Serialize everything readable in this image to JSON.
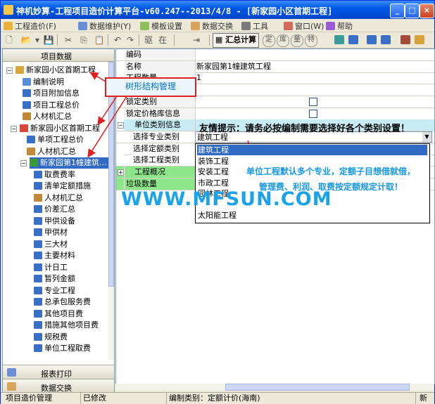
{
  "window": {
    "title": "神机妙算-工程项目造价计算平台-v60.247--2013/4/8 - [新家园小区首期工程]",
    "controls": {
      "minimize": "_",
      "maximize": "□",
      "close": "×"
    }
  },
  "menu": [
    {
      "label": "工程造价(F)",
      "icon": "folder-icon",
      "color": "#e8b23a"
    },
    {
      "label": "数据维护(Y)",
      "icon": "database-icon",
      "color": "#6b8fd6"
    },
    {
      "label": "模板设置",
      "icon": "template-icon",
      "color": "#8fbf5a"
    },
    {
      "label": "数据交换",
      "icon": "exchange-icon",
      "color": "#d6a45a"
    },
    {
      "label": "工具",
      "icon": "tools-icon",
      "color": "#7a7a7a"
    },
    {
      "label": "窗口(W)",
      "icon": "window-icon",
      "color": "#d66a5a"
    },
    {
      "label": "帮助",
      "icon": "help-icon",
      "color": "#9a5ad6"
    }
  ],
  "toolbar": {
    "glyphs": [
      "🗋",
      "📂",
      "▾",
      "💾",
      "✂",
      "⎘",
      "📋",
      "↶",
      "↷",
      "驱",
      "在",
      "⇥",
      "⎙"
    ],
    "calc_label": "汇总计算",
    "glyphs2": [
      "定",
      "库",
      "量",
      "特"
    ]
  },
  "left_panel": {
    "header": "项目数据",
    "tree": [
      {
        "label": "新家园小区首期工程",
        "level": 0,
        "expander": "−",
        "icon_color": "#d9a63a"
      },
      {
        "label": "编制说明",
        "level": 1,
        "icon_color": "#5a8fd6"
      },
      {
        "label": "项目附加信息",
        "level": 1,
        "icon_color": "#3a6fc6"
      },
      {
        "label": "项目工程总价",
        "level": 1,
        "icon_color": "#3a6fc6"
      },
      {
        "label": "人材机汇总",
        "level": 1,
        "icon_color": "#c08a3a"
      },
      {
        "label": "新家园小区首期工程",
        "level": 1,
        "expander": "−",
        "icon_color": "#d9463a"
      },
      {
        "label": "单项工程总价",
        "level": 2,
        "icon_color": "#3a6fc6"
      },
      {
        "label": "人材机汇总",
        "level": 2,
        "icon_color": "#c08a3a"
      },
      {
        "label": "新家园第1幢建筑...",
        "level": 2,
        "expander": "−",
        "icon_color": "#3a9a3a",
        "selected": true
      },
      {
        "label": "取费费率",
        "level": 3,
        "icon_color": "#3a6fc6"
      },
      {
        "label": "清单定额措施",
        "level": 3,
        "icon_color": "#3a6fc6"
      },
      {
        "label": "人材机汇总",
        "level": 3,
        "icon_color": "#c08a3a"
      },
      {
        "label": "价差汇总",
        "level": 3,
        "icon_color": "#3a6fc6"
      },
      {
        "label": "甲供设备",
        "level": 3,
        "icon_color": "#3a6fc6"
      },
      {
        "label": "甲供材",
        "level": 3,
        "icon_color": "#3a6fc6"
      },
      {
        "label": "三大材",
        "level": 3,
        "icon_color": "#3a6fc6"
      },
      {
        "label": "主要材料",
        "level": 3,
        "icon_color": "#3a6fc6"
      },
      {
        "label": "计日工",
        "level": 3,
        "icon_color": "#3a6fc6"
      },
      {
        "label": "暂列金额",
        "level": 3,
        "icon_color": "#3a6fc6"
      },
      {
        "label": "专业工程",
        "level": 3,
        "icon_color": "#3a6fc6"
      },
      {
        "label": "总承包服务费",
        "level": 3,
        "icon_color": "#3a6fc6"
      },
      {
        "label": "其他项目费",
        "level": 3,
        "icon_color": "#3a6fc6"
      },
      {
        "label": "措施其他项目费",
        "level": 3,
        "icon_color": "#3a6fc6"
      },
      {
        "label": "规税费",
        "level": 3,
        "icon_color": "#3a6fc6"
      },
      {
        "label": "单位工程取费",
        "level": 3,
        "icon_color": "#3a6fc6"
      }
    ],
    "report_button": "报表打印",
    "exchange_button": "数据交换"
  },
  "properties": {
    "rows": [
      {
        "key": "编码",
        "value": ""
      },
      {
        "key": "名称",
        "value": "新家园第1幢建筑工程"
      },
      {
        "key": "工程数量",
        "value": "1"
      },
      {
        "key": "",
        "value": ""
      },
      {
        "key": "锁定类别",
        "value": "",
        "checkbox": true
      },
      {
        "key": "锁定价格库信息",
        "value": "",
        "checkbox": true
      }
    ],
    "section_unit": {
      "expander": "−",
      "label": "单位类别信息",
      "tip": "友情提示：请务必按编制需要选择好各个类别设置！"
    },
    "sub_rows": [
      {
        "key": "选择专业类别",
        "value": "建筑工程"
      },
      {
        "key": "选择定额类别",
        "value": ""
      },
      {
        "key": "选择工程类别",
        "value": ""
      }
    ],
    "section_overview": {
      "expander": "+",
      "label": "工程概况"
    },
    "section_garbage": {
      "label": "垃圾数量"
    }
  },
  "dropdown": {
    "options": [
      "建筑工程",
      "装饰工程",
      "安装工程",
      "市政工程",
      "园林工程",
      "",
      "太阳能工程"
    ],
    "selected": 0
  },
  "annotations": {
    "tree_callout": "树形结构管理",
    "note_lines": [
      "单位工程默认多个专业，定额子目想借就借，",
      "管理费、利润、取费按定额规定计取！"
    ],
    "watermark": "WWW.MFSUN.COM",
    "arrow_color": "#e11f1f"
  },
  "statusbar": {
    "module": "项目造价管理",
    "state": "已修改",
    "compile_type": "编制类别：定额计价(海南)",
    "target": "新"
  }
}
